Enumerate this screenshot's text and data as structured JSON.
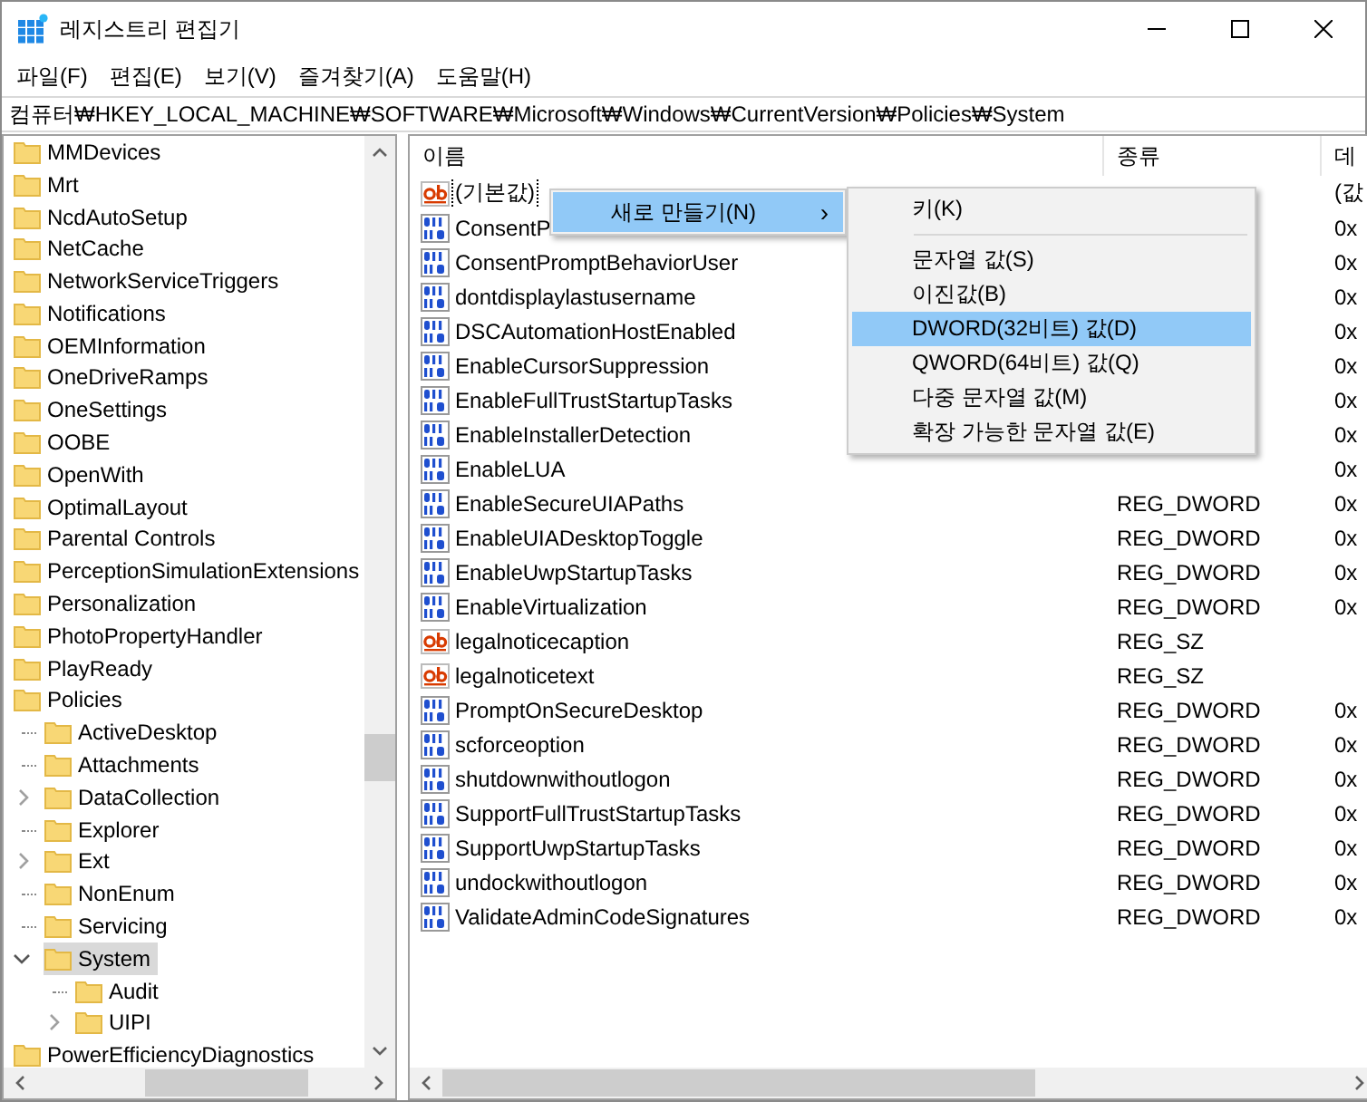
{
  "window": {
    "title": "레지스트리 편집기"
  },
  "menu_bar": [
    "파일(F)",
    "편집(E)",
    "보기(V)",
    "즐겨찾기(A)",
    "도움말(H)"
  ],
  "address": "컴퓨터₩HKEY_LOCAL_MACHINE₩SOFTWARE₩Microsoft₩Windows₩CurrentVersion₩Policies₩System",
  "tree": [
    {
      "label": "MMDevices",
      "selected": false
    },
    {
      "label": "Mrt",
      "selected": false
    },
    {
      "label": "NcdAutoSetup",
      "selected": false
    },
    {
      "label": "NetCache",
      "selected": false
    },
    {
      "label": "NetworkServiceTriggers",
      "selected": false
    },
    {
      "label": "Notifications",
      "selected": false
    },
    {
      "label": "OEMInformation",
      "selected": false
    },
    {
      "label": "OneDriveRamps",
      "selected": false
    },
    {
      "label": "OneSettings",
      "selected": false
    },
    {
      "label": "OOBE",
      "selected": false
    },
    {
      "label": "OpenWith",
      "selected": false
    },
    {
      "label": "OptimalLayout",
      "selected": false
    },
    {
      "label": "Parental Controls",
      "selected": false
    },
    {
      "label": "PerceptionSimulationExtensions",
      "selected": false
    },
    {
      "label": "Personalization",
      "selected": false
    },
    {
      "label": "PhotoPropertyHandler",
      "selected": false
    },
    {
      "label": "PlayReady",
      "selected": false
    },
    {
      "label": "Policies",
      "selected": false,
      "children": [
        {
          "label": "ActiveDesktop",
          "selected": false
        },
        {
          "label": "Attachments",
          "selected": false
        },
        {
          "label": "DataCollection",
          "expanded": false,
          "selected": false
        },
        {
          "label": "Explorer",
          "selected": false
        },
        {
          "label": "Ext",
          "expanded": false,
          "selected": false
        },
        {
          "label": "NonEnum",
          "selected": false
        },
        {
          "label": "Servicing",
          "selected": false
        },
        {
          "label": "System",
          "expanded": true,
          "selected": true,
          "children": [
            {
              "label": "Audit",
              "selected": false
            },
            {
              "label": "UIPI",
              "expanded": false,
              "selected": false
            }
          ]
        }
      ]
    },
    {
      "label": "PowerEfficiencyDiagnostics",
      "selected": false
    }
  ],
  "table": {
    "columns": [
      "이름",
      "종류",
      "데"
    ],
    "rows": [
      {
        "kind": "string",
        "name": "(기본값)",
        "focused": true,
        "data": "(값"
      },
      {
        "kind": "binary",
        "name": "ConsentP",
        "focused": false,
        "data": "0x"
      },
      {
        "kind": "binary",
        "name": "ConsentPromptBehaviorUser",
        "focused": false,
        "data": "0x"
      },
      {
        "kind": "binary",
        "name": "dontdisplaylastusername",
        "focused": false,
        "data": "0x"
      },
      {
        "kind": "binary",
        "name": "DSCAutomationHostEnabled",
        "focused": false,
        "data": "0x"
      },
      {
        "kind": "binary",
        "name": "EnableCursorSuppression",
        "focused": false,
        "data": "0x"
      },
      {
        "kind": "binary",
        "name": "EnableFullTrustStartupTasks",
        "focused": false,
        "data": "0x"
      },
      {
        "kind": "binary",
        "name": "EnableInstallerDetection",
        "focused": false,
        "data": "0x"
      },
      {
        "kind": "binary",
        "name": "EnableLUA",
        "focused": false,
        "data": "0x"
      },
      {
        "kind": "binary",
        "name": "EnableSecureUIAPaths",
        "focused": false,
        "type": "REG_DWORD",
        "data": "0x"
      },
      {
        "kind": "binary",
        "name": "EnableUIADesktopToggle",
        "focused": false,
        "type": "REG_DWORD",
        "data": "0x"
      },
      {
        "kind": "binary",
        "name": "EnableUwpStartupTasks",
        "focused": false,
        "type": "REG_DWORD",
        "data": "0x"
      },
      {
        "kind": "binary",
        "name": "EnableVirtualization",
        "focused": false,
        "type": "REG_DWORD",
        "data": "0x"
      },
      {
        "kind": "string",
        "name": "legalnoticecaption",
        "focused": false,
        "type": "REG_SZ"
      },
      {
        "kind": "string",
        "name": "legalnoticetext",
        "focused": false,
        "type": "REG_SZ"
      },
      {
        "kind": "binary",
        "name": "PromptOnSecureDesktop",
        "focused": false,
        "type": "REG_DWORD",
        "data": "0x"
      },
      {
        "kind": "binary",
        "name": "scforceoption",
        "focused": false,
        "type": "REG_DWORD",
        "data": "0x"
      },
      {
        "kind": "binary",
        "name": "shutdownwithoutlogon",
        "focused": false,
        "type": "REG_DWORD",
        "data": "0x"
      },
      {
        "kind": "binary",
        "name": "SupportFullTrustStartupTasks",
        "focused": false,
        "type": "REG_DWORD",
        "data": "0x"
      },
      {
        "kind": "binary",
        "name": "SupportUwpStartupTasks",
        "focused": false,
        "type": "REG_DWORD",
        "data": "0x"
      },
      {
        "kind": "binary",
        "name": "undockwithoutlogon",
        "focused": false,
        "type": "REG_DWORD",
        "data": "0x"
      },
      {
        "kind": "binary",
        "name": "ValidateAdminCodeSignatures",
        "focused": false,
        "type": "REG_DWORD",
        "data": "0x"
      }
    ]
  },
  "context_menu": {
    "label": "새로 만들기(N)",
    "arrow": "›",
    "selected": true
  },
  "submenu": [
    {
      "kind": "item",
      "label": "키(K)",
      "selected": false
    },
    {
      "kind": "separator"
    },
    {
      "kind": "item",
      "label": "문자열 값(S)",
      "selected": false
    },
    {
      "kind": "item",
      "label": "이진값(B)",
      "selected": false
    },
    {
      "kind": "item",
      "label": "DWORD(32비트) 값(D)",
      "selected": true
    },
    {
      "kind": "item",
      "label": "QWORD(64비트) 값(Q)",
      "selected": false
    },
    {
      "kind": "item",
      "label": "다중 문자열 값(M)",
      "selected": false
    },
    {
      "kind": "item",
      "label": "확장 가능한 문자열 값(E)",
      "selected": false
    }
  ]
}
